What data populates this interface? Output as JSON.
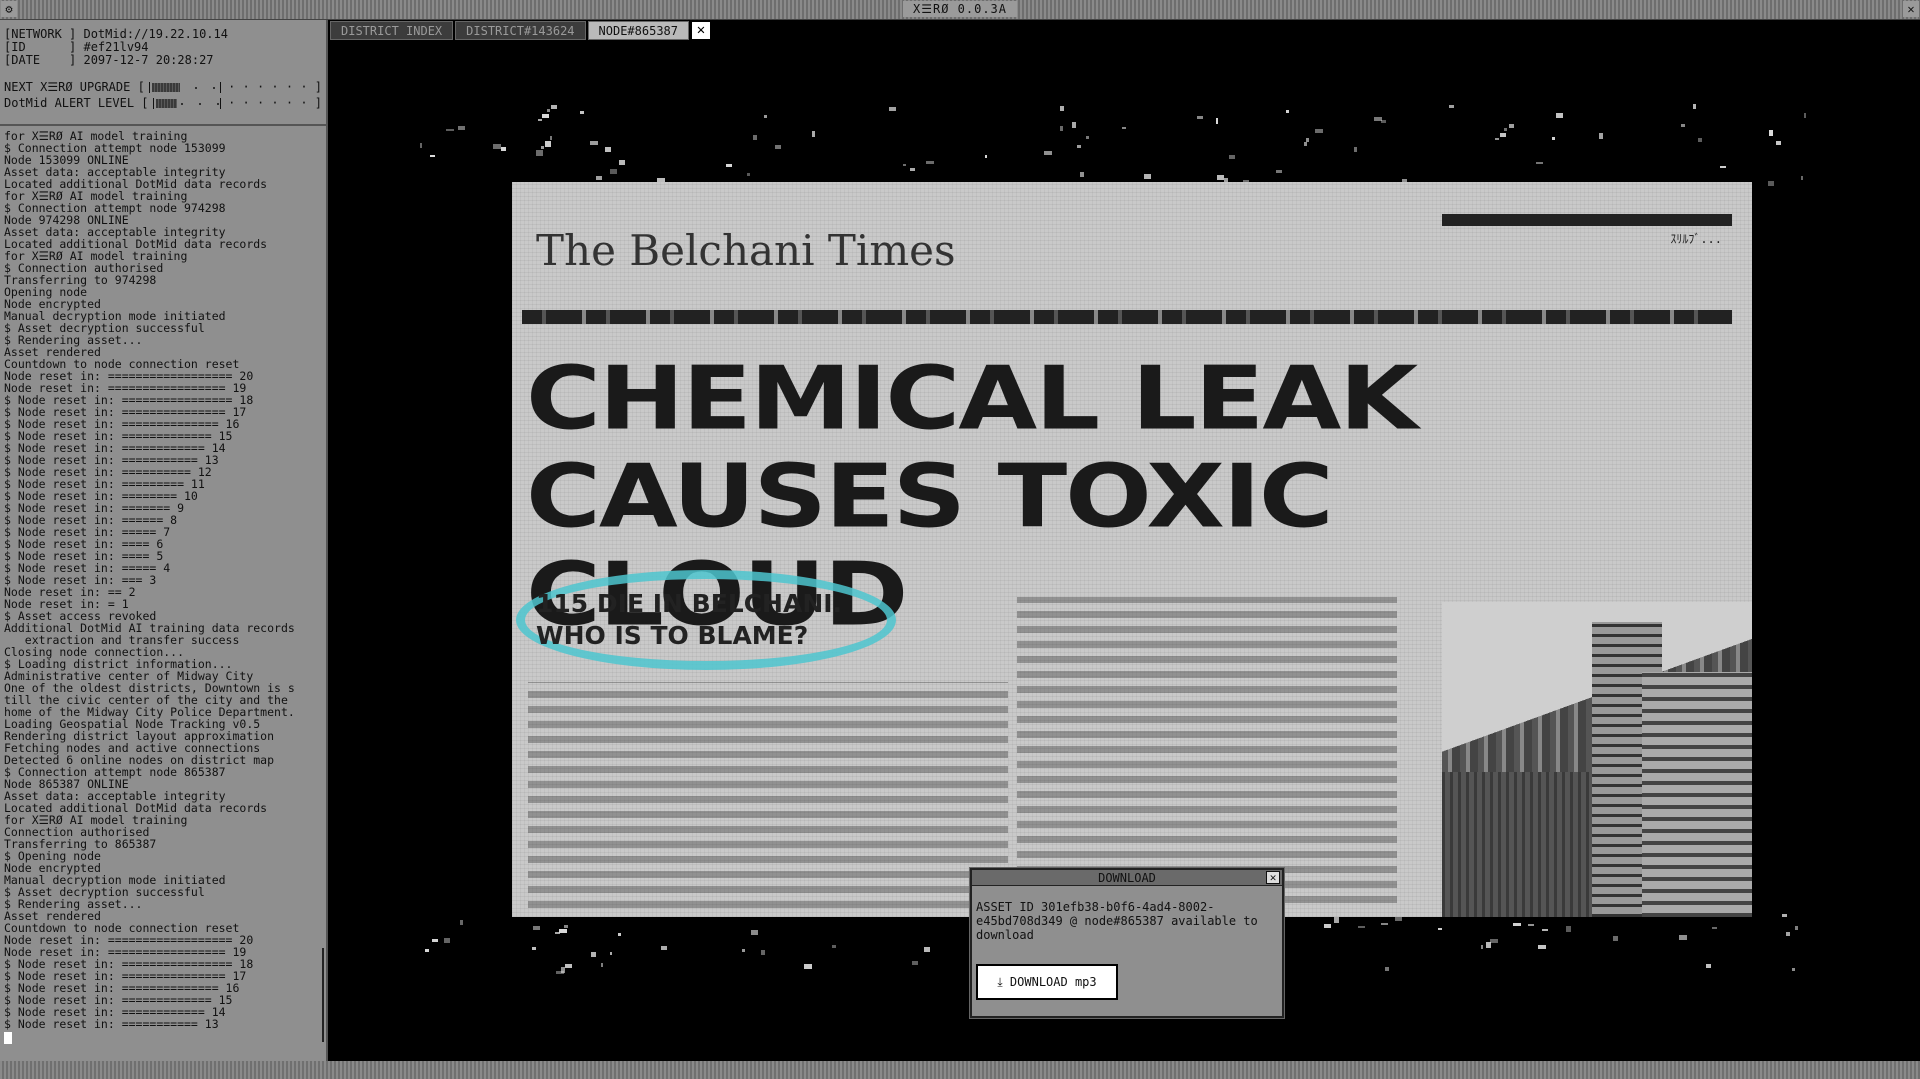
{
  "window": {
    "title": "X☰RØ 0.0.3A",
    "left_glyph": "⚙",
    "right_glyph": "✕"
  },
  "info": {
    "rows": [
      "[NETWORK ] DotMid://19.22.10.14",
      "[ID      ] #ef21lv94",
      "[DATE    ] 2097-12-7 20:28:27"
    ],
    "meters": [
      {
        "label": "NEXT X☰RØ UPGRADE [",
        "level": 0.4,
        "end": " · · · · · · ]"
      },
      {
        "label": "DotMid ALERT LEVEL [",
        "level": 0.33,
        "end": " · · · · · · ]"
      }
    ]
  },
  "log": [
    "for X☰RØ AI model training",
    "$ Connection attempt node 153099",
    "Node 153099 ONLINE",
    "Asset data: acceptable integrity",
    "Located additional DotMid data records",
    "for X☰RØ AI model training",
    "$ Connection attempt node 974298",
    "Node 974298 ONLINE",
    "Asset data: acceptable integrity",
    "Located additional DotMid data records",
    "for X☰RØ AI model training",
    "$ Connection authorised",
    "Transferring to 974298",
    "Opening node",
    "Node encrypted",
    "Manual decryption mode initiated",
    "$ Asset decryption successful",
    "$ Rendering asset...",
    "Asset rendered",
    "Countdown to node connection reset",
    "Node reset in: ================== 20",
    "Node reset in: ================= 19",
    "$ Node reset in: ================ 18",
    "$ Node reset in: =============== 17",
    "$ Node reset in: ============== 16",
    "$ Node reset in: ============= 15",
    "$ Node reset in: ============ 14",
    "$ Node reset in: =========== 13",
    "$ Node reset in: ========== 12",
    "$ Node reset in: ========= 11",
    "$ Node reset in: ======== 10",
    "$ Node reset in: ======= 9",
    "$ Node reset in: ====== 8",
    "$ Node reset in: ===== 7",
    "$ Node reset in: ==== 6",
    "$ Node reset in: ==== 5",
    "$ Node reset in: ===== 4",
    "$ Node reset in: === 3",
    "Node reset in: == 2",
    "Node reset in: = 1",
    "$ Asset access revoked",
    "Additional DotMid AI training data records",
    "   extraction and transfer success",
    "Closing node connection...",
    "$ Loading district information...",
    "Administrative center of Midway City",
    "One of the oldest districts, Downtown is s",
    "till the civic center of the city and the",
    "home of the Midway City Police Department.",
    "Loading Geospatial Node Tracking v0.5",
    "Rendering district layout approximation",
    "Fetching nodes and active connections",
    "Detected 6 online nodes on district map",
    "$ Connection attempt node 865387",
    "Node 865387 ONLINE",
    "Asset data: acceptable integrity",
    "Located additional DotMid data records",
    "for X☰RØ AI model training",
    "Connection authorised",
    "Transferring to 865387",
    "$ Opening node",
    "Node encrypted",
    "Manual decryption mode initiated",
    "$ Asset decryption successful",
    "$ Rendering asset...",
    "Asset rendered",
    "Countdown to node connection reset",
    "Node reset in: ================== 20",
    "Node reset in: ================= 19",
    "$ Node reset in: ================ 18",
    "$ Node reset in: =============== 17",
    "$ Node reset in: ============== 16",
    "$ Node reset in: ============= 15",
    "$ Node reset in: ============ 14",
    "$ Node reset in: =========== 13"
  ],
  "tabs": [
    {
      "label": "DISTRICT INDEX",
      "active": false
    },
    {
      "label": "DISTRICT#143624",
      "active": false
    },
    {
      "label": "NODE#865387",
      "active": true
    }
  ],
  "tab_close": "✕",
  "newspaper": {
    "masthead": "The Belchani Times",
    "topbar_text": "ｽﾘﾙﾌﾞ...",
    "headline_1": "CHEMICAL LEAK",
    "headline_2": "CAUSES TOXIC CLOUD",
    "subhead": "115 DIE IN BELCHANI. WHO IS TO BLAME?"
  },
  "dialog": {
    "title": "DOWNLOAD",
    "close": "✕",
    "message": "ASSET ID 301efb38-b0f6-4ad4-8002-e45bd708d349 @ node#865387 available to download",
    "button_icon": "⤓",
    "button_label": "DOWNLOAD mp3"
  },
  "colors": {
    "accent_ring": "#4ec6cf",
    "panel": "#8f8f8f"
  }
}
